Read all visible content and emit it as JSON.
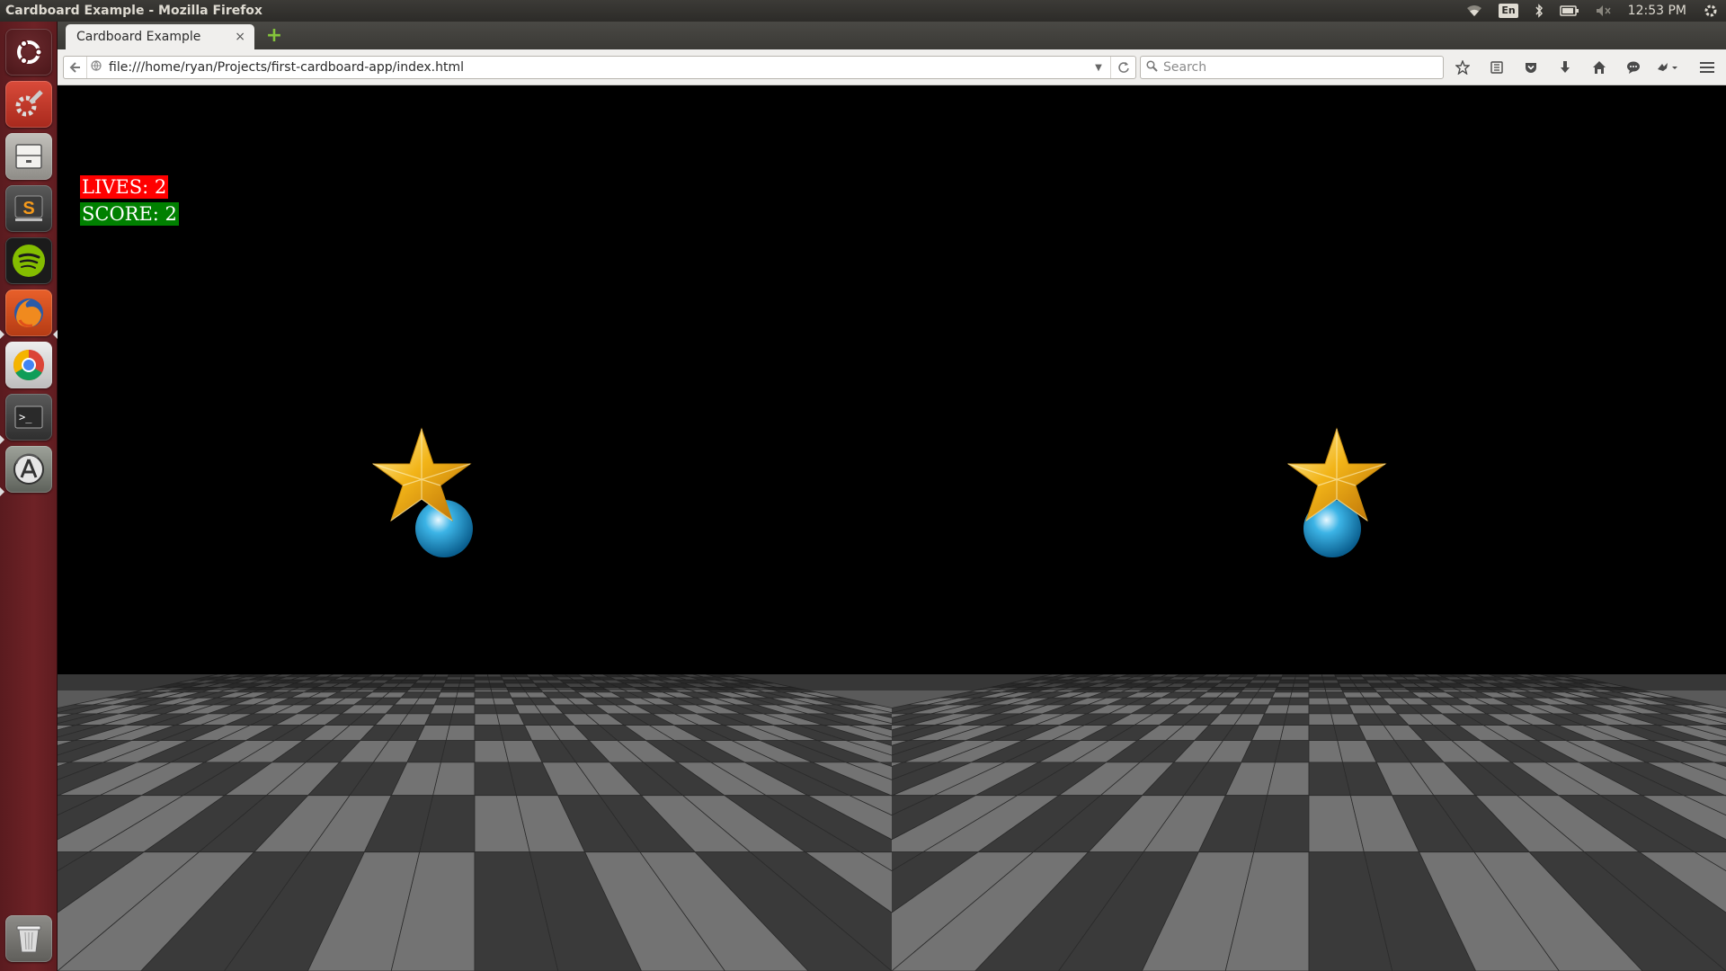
{
  "top_panel": {
    "window_title": "Cardboard Example - Mozilla Firefox",
    "keyboard_layout": "En",
    "clock": "12:53 PM",
    "icons": [
      "wifi-icon",
      "keyboard-icon",
      "bluetooth-icon",
      "battery-icon",
      "volume-muted-icon",
      "settings-gear-icon"
    ]
  },
  "launcher": {
    "items": [
      {
        "name": "ubuntu-dash",
        "icon": "ubuntu-logo-icon"
      },
      {
        "name": "system-settings",
        "icon": "settings-tools-icon"
      },
      {
        "name": "files",
        "icon": "file-cabinet-icon"
      },
      {
        "name": "sublime-text",
        "icon": "sublime-text-icon",
        "label": "S"
      },
      {
        "name": "spotify",
        "icon": "spotify-icon"
      },
      {
        "name": "firefox",
        "icon": "firefox-icon"
      },
      {
        "name": "chrome",
        "icon": "chrome-icon"
      },
      {
        "name": "terminal",
        "icon": "terminal-icon",
        "label": ">_"
      },
      {
        "name": "software-updater",
        "icon": "software-updater-icon"
      },
      {
        "name": "trash",
        "icon": "trash-icon"
      }
    ]
  },
  "browser": {
    "tab": {
      "title": "Cardboard Example",
      "close": "×"
    },
    "new_tab": "+",
    "url": "file:///home/ryan/Projects/first-cardboard-app/index.html",
    "search_placeholder": "Search",
    "toolbar_icons": [
      "bookmark-star-icon",
      "reading-list-icon",
      "pocket-icon",
      "download-icon",
      "home-icon",
      "chat-icon",
      "extensions-icon"
    ]
  },
  "page": {
    "lives_label": "LIVES: 2",
    "score_label": "SCORE: 2"
  },
  "colors": {
    "lives_bg": "#ff0000",
    "score_bg": "#008000",
    "launcher_bg": "#6e2226",
    "star": "#f2b418",
    "sphere": "#1f9fd6"
  }
}
